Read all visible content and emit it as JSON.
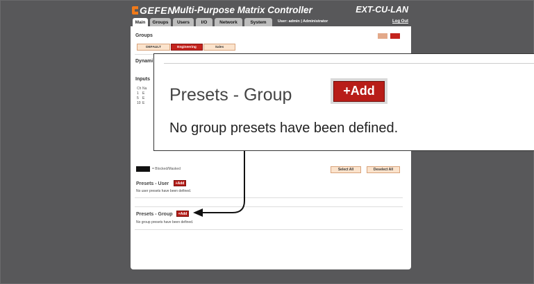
{
  "header": {
    "logo": "GEFEN",
    "title": "Multi-Purpose Matrix Controller",
    "model": "EXT-CU-LAN"
  },
  "tabs": [
    {
      "label": "Main"
    },
    {
      "label": "Groups"
    },
    {
      "label": "Users"
    },
    {
      "label": "I/O"
    },
    {
      "label": "Network"
    },
    {
      "label": "System"
    }
  ],
  "userbar": {
    "user_info": "User: admin  |  Administrator",
    "logout": "Log Out"
  },
  "groups": {
    "title": "Groups",
    "buttons": [
      {
        "label": "DEFAULT"
      },
      {
        "label": "Engineering"
      },
      {
        "label": "Sales"
      }
    ],
    "active": "Engineering"
  },
  "dynamic": {
    "title_partial": "Dynami"
  },
  "inputs": {
    "title": "Inputs",
    "col_ch": "Ch",
    "col_name_partial": "Na",
    "rows": [
      {
        "ch": "1",
        "name_partial": "E"
      },
      {
        "ch": "5",
        "name_partial": "E"
      },
      {
        "ch": "10",
        "name_partial": "E"
      }
    ]
  },
  "legend": {
    "label": "= Blocked/Masked"
  },
  "selection": {
    "select_all": "Select All",
    "deselect_all": "Deselect All"
  },
  "presets_user": {
    "title": "Presets - User",
    "add_label": "+Add",
    "message": "No user presets have been defined."
  },
  "presets_group": {
    "title": "Presets - Group",
    "add_label": "+Add",
    "message": "No group presets have been defined."
  },
  "callout": {
    "title": "Presets - Group",
    "add_label": "+Add",
    "message": "No group presets have been defined."
  },
  "colors": {
    "background": "#58585a",
    "accent_red": "#b81d18",
    "button_peach": "#fbe3cc",
    "logo_orange": "#f07a1a"
  }
}
